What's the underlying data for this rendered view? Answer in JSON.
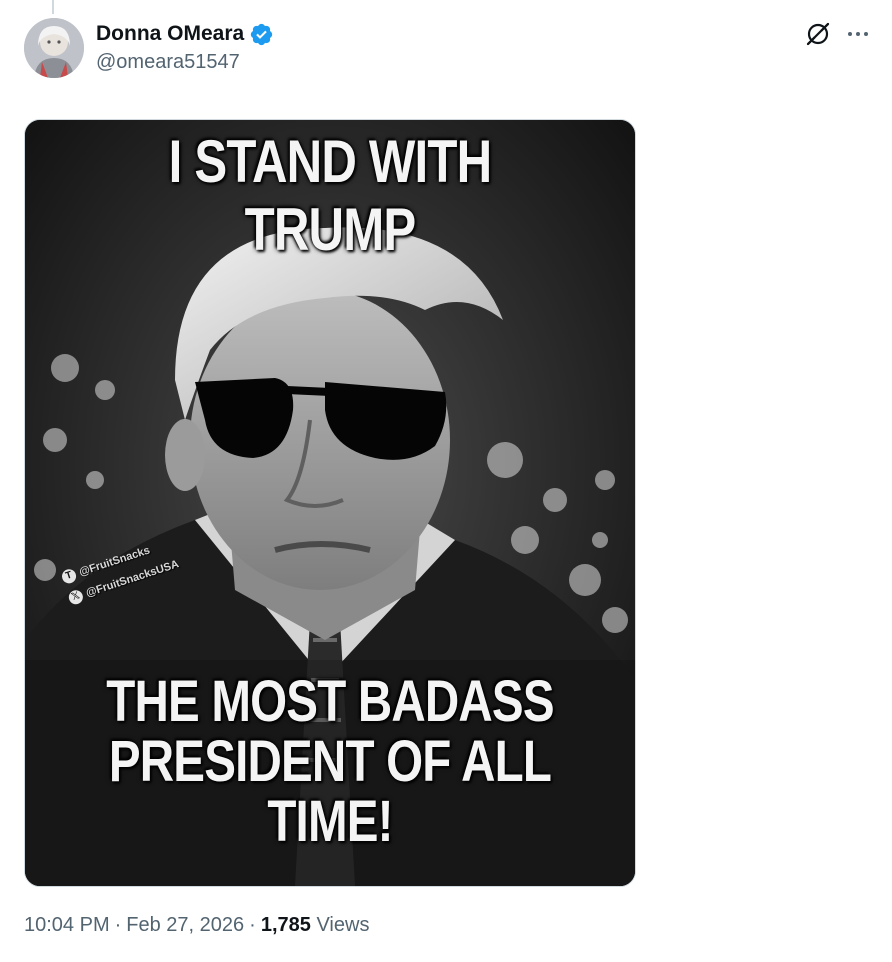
{
  "tweet": {
    "author": {
      "display_name": "Donna OMeara",
      "handle": "@omeara51547",
      "verified": true,
      "verified_color": "#1d9bf0"
    },
    "media": {
      "top_text": "I STAND WITH TRUMP",
      "bottom_text_line1": "THE MOST BADASS",
      "bottom_text_line2": "PRESIDENT OF ALL",
      "bottom_text_line3": "TIME!",
      "watermark_line1": "@FruitSnacks",
      "watermark_line2": "@FruitSnacksUSA"
    },
    "meta": {
      "time": "10:04 PM",
      "date": "Feb 27, 2026",
      "separator": "·",
      "views_count": "1,785",
      "views_label": "Views"
    },
    "icons": {
      "grok": "grok-icon",
      "more": "more-icon",
      "verified": "verified-badge-icon"
    }
  }
}
